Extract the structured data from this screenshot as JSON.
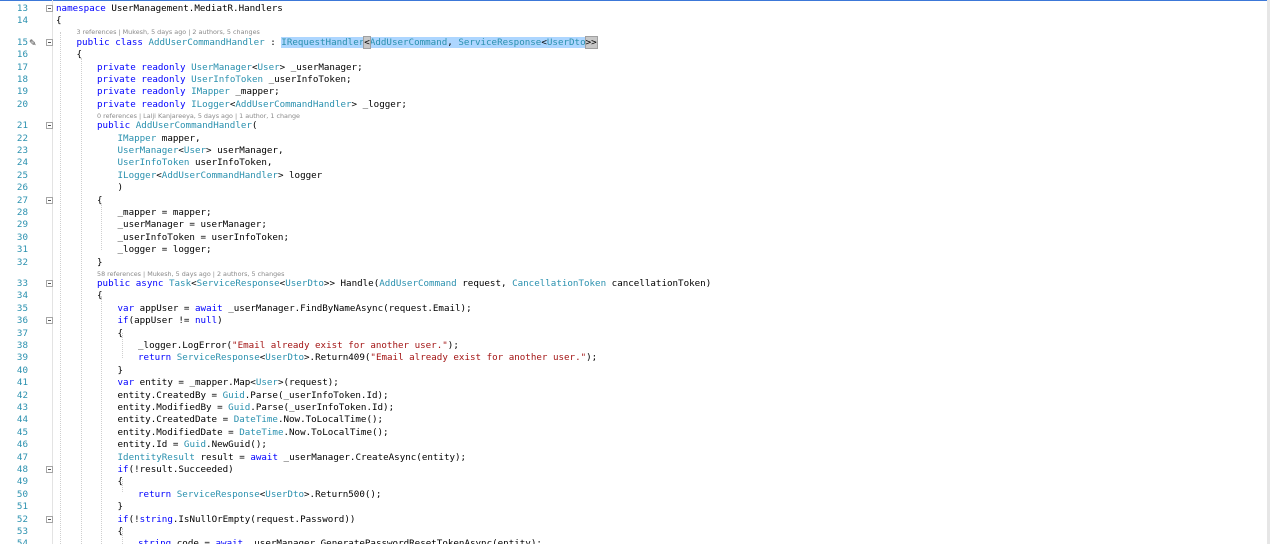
{
  "editor": {
    "lines": [
      {
        "n": "13",
        "indent": 0,
        "fold": "open",
        "segs": [
          [
            "k",
            "namespace"
          ],
          [
            "",
            "UserManagement.MediatR.Handlers"
          ]
        ]
      },
      {
        "n": "14",
        "indent": 0,
        "segs": [
          [
            "",
            "{"
          ]
        ]
      },
      {
        "lens": "3 references | Mukesh, 5 days ago | 2 authors, 5 changes",
        "indent": 1
      },
      {
        "n": "15",
        "indent": 1,
        "fold": "open",
        "editicon": true,
        "segs": [
          [
            "k",
            "public"
          ],
          [
            "",
            ""
          ],
          [
            "k",
            "class"
          ],
          [
            "",
            ""
          ],
          [
            "t",
            "AddUserCommandHandler"
          ],
          [
            "",
            ":"
          ],
          [
            "sel-t",
            "IRequestHandler"
          ],
          [
            "sel-b",
            "<"
          ],
          [
            "sel-t",
            "AddUserCommand"
          ],
          [
            "sel",
            ","
          ],
          [
            "sel-t",
            "ServiceResponse"
          ],
          [
            "sel",
            "<"
          ],
          [
            "sel-t",
            "UserDto"
          ],
          [
            "sel-b",
            ">>"
          ]
        ]
      },
      {
        "n": "16",
        "indent": 1,
        "segs": [
          [
            "",
            "{"
          ]
        ]
      },
      {
        "n": "17",
        "indent": 2,
        "segs": [
          [
            "k",
            "private"
          ],
          [
            "k",
            "readonly"
          ],
          [
            "t",
            "UserManager"
          ],
          [
            "",
            "<"
          ],
          [
            "t",
            "User"
          ],
          [
            "",
            "> _userManager;"
          ]
        ]
      },
      {
        "n": "18",
        "indent": 2,
        "segs": [
          [
            "k",
            "private"
          ],
          [
            "k",
            "readonly"
          ],
          [
            "t",
            "UserInfoToken"
          ],
          [
            "",
            "_userInfoToken;"
          ]
        ]
      },
      {
        "n": "19",
        "indent": 2,
        "segs": [
          [
            "k",
            "private"
          ],
          [
            "k",
            "readonly"
          ],
          [
            "t",
            "IMapper"
          ],
          [
            "",
            "_mapper;"
          ]
        ]
      },
      {
        "n": "20",
        "indent": 2,
        "segs": [
          [
            "k",
            "private"
          ],
          [
            "k",
            "readonly"
          ],
          [
            "t",
            "ILogger"
          ],
          [
            "",
            "<"
          ],
          [
            "t",
            "AddUserCommandHandler"
          ],
          [
            "",
            "> _logger;"
          ]
        ]
      },
      {
        "lens": "0 references | Lalji Kanjareeya, 5 days ago | 1 author, 1 change",
        "indent": 2
      },
      {
        "n": "21",
        "indent": 2,
        "fold": "open",
        "segs": [
          [
            "k",
            "public"
          ],
          [
            "t",
            "AddUserCommandHandler"
          ],
          [
            "",
            "("
          ]
        ]
      },
      {
        "n": "22",
        "indent": 3,
        "segs": [
          [
            "t",
            "IMapper"
          ],
          [
            "",
            "mapper,"
          ]
        ]
      },
      {
        "n": "23",
        "indent": 3,
        "segs": [
          [
            "t",
            "UserManager"
          ],
          [
            "",
            "<"
          ],
          [
            "t",
            "User"
          ],
          [
            "",
            "> userManager,"
          ]
        ]
      },
      {
        "n": "24",
        "indent": 3,
        "segs": [
          [
            "t",
            "UserInfoToken"
          ],
          [
            "",
            "userInfoToken,"
          ]
        ]
      },
      {
        "n": "25",
        "indent": 3,
        "segs": [
          [
            "t",
            "ILogger"
          ],
          [
            "",
            "<"
          ],
          [
            "t",
            "AddUserCommandHandler"
          ],
          [
            "",
            "> logger"
          ]
        ]
      },
      {
        "n": "26",
        "indent": 3,
        "segs": [
          [
            "",
            ")"
          ]
        ]
      },
      {
        "n": "27",
        "indent": 2,
        "fold": "open",
        "segs": [
          [
            "",
            "{"
          ]
        ]
      },
      {
        "n": "28",
        "indent": 3,
        "segs": [
          [
            "",
            "_mapper = mapper;"
          ]
        ]
      },
      {
        "n": "29",
        "indent": 3,
        "segs": [
          [
            "",
            "_userManager = userManager;"
          ]
        ]
      },
      {
        "n": "30",
        "indent": 3,
        "segs": [
          [
            "",
            "_userInfoToken = userInfoToken;"
          ]
        ]
      },
      {
        "n": "31",
        "indent": 3,
        "segs": [
          [
            "",
            "_logger = logger;"
          ]
        ]
      },
      {
        "n": "32",
        "indent": 2,
        "segs": [
          [
            "",
            "}"
          ]
        ]
      },
      {
        "lens": "58 references | Mukesh, 5 days ago | 2 authors, 5 changes",
        "indent": 2
      },
      {
        "n": "33",
        "indent": 2,
        "fold": "open",
        "segs": [
          [
            "k",
            "public"
          ],
          [
            "k",
            "async"
          ],
          [
            "t",
            "Task"
          ],
          [
            "",
            "<"
          ],
          [
            "t",
            "ServiceResponse"
          ],
          [
            "",
            "<"
          ],
          [
            "t",
            "UserDto"
          ],
          [
            "",
            ">> Handle("
          ],
          [
            "t",
            "AddUserCommand"
          ],
          [
            "",
            "request,"
          ],
          [
            "t",
            "CancellationToken"
          ],
          [
            "",
            "cancellationToken)"
          ]
        ]
      },
      {
        "n": "34",
        "indent": 2,
        "segs": [
          [
            "",
            "{"
          ]
        ]
      },
      {
        "n": "35",
        "indent": 3,
        "segs": [
          [
            "k",
            "var"
          ],
          [
            "",
            "appUser ="
          ],
          [
            "k",
            "await"
          ],
          [
            "",
            "_userManager.FindByNameAsync(request.Email);"
          ]
        ]
      },
      {
        "n": "36",
        "indent": 3,
        "fold": "open",
        "segs": [
          [
            "k",
            "if"
          ],
          [
            "",
            "(appUser !="
          ],
          [
            "k",
            "null"
          ],
          [
            "",
            ")"
          ]
        ]
      },
      {
        "n": "37",
        "indent": 3,
        "segs": [
          [
            "",
            "{"
          ]
        ]
      },
      {
        "n": "38",
        "indent": 4,
        "segs": [
          [
            "",
            "_logger.LogError("
          ],
          [
            "s",
            "\"Email already exist for another user.\""
          ],
          [
            "",
            ");"
          ]
        ]
      },
      {
        "n": "39",
        "indent": 4,
        "segs": [
          [
            "k",
            "return"
          ],
          [
            "t",
            "ServiceResponse"
          ],
          [
            "",
            "<"
          ],
          [
            "t",
            "UserDto"
          ],
          [
            "",
            ">.Return409("
          ],
          [
            "s",
            "\"Email already exist for another user.\""
          ],
          [
            "",
            ");"
          ]
        ]
      },
      {
        "n": "40",
        "indent": 3,
        "segs": [
          [
            "",
            "}"
          ]
        ]
      },
      {
        "n": "41",
        "indent": 3,
        "segs": [
          [
            "k",
            "var"
          ],
          [
            "",
            "entity = _mapper.Map<"
          ],
          [
            "t",
            "User"
          ],
          [
            "",
            ">(request);"
          ]
        ]
      },
      {
        "n": "42",
        "indent": 3,
        "segs": [
          [
            "",
            "entity.CreatedBy ="
          ],
          [
            "t",
            "Guid"
          ],
          [
            "",
            ".Parse(_userInfoToken.Id);"
          ]
        ]
      },
      {
        "n": "43",
        "indent": 3,
        "segs": [
          [
            "",
            "entity.ModifiedBy ="
          ],
          [
            "t",
            "Guid"
          ],
          [
            "",
            ".Parse(_userInfoToken.Id);"
          ]
        ]
      },
      {
        "n": "44",
        "indent": 3,
        "segs": [
          [
            "",
            "entity.CreatedDate ="
          ],
          [
            "t",
            "DateTime"
          ],
          [
            "",
            ".Now.ToLocalTime();"
          ]
        ]
      },
      {
        "n": "45",
        "indent": 3,
        "segs": [
          [
            "",
            "entity.ModifiedDate ="
          ],
          [
            "t",
            "DateTime"
          ],
          [
            "",
            ".Now.ToLocalTime();"
          ]
        ]
      },
      {
        "n": "46",
        "indent": 3,
        "segs": [
          [
            "",
            "entity.Id ="
          ],
          [
            "t",
            "Guid"
          ],
          [
            "",
            ".NewGuid();"
          ]
        ]
      },
      {
        "n": "47",
        "indent": 3,
        "segs": [
          [
            "t",
            "IdentityResult"
          ],
          [
            "",
            "result ="
          ],
          [
            "k",
            "await"
          ],
          [
            "",
            "_userManager.CreateAsync(entity);"
          ]
        ]
      },
      {
        "n": "48",
        "indent": 3,
        "fold": "open",
        "segs": [
          [
            "k",
            "if"
          ],
          [
            "",
            "(!result.Succeeded)"
          ]
        ]
      },
      {
        "n": "49",
        "indent": 3,
        "segs": [
          [
            "",
            "{"
          ]
        ]
      },
      {
        "n": "50",
        "indent": 4,
        "segs": [
          [
            "k",
            "return"
          ],
          [
            "t",
            "ServiceResponse"
          ],
          [
            "",
            "<"
          ],
          [
            "t",
            "UserDto"
          ],
          [
            "",
            ">.Return500();"
          ]
        ]
      },
      {
        "n": "51",
        "indent": 3,
        "segs": [
          [
            "",
            "}"
          ]
        ]
      },
      {
        "n": "52",
        "indent": 3,
        "fold": "open",
        "segs": [
          [
            "k",
            "if"
          ],
          [
            "",
            "(!"
          ],
          [
            "k",
            "string"
          ],
          [
            "",
            ".IsNullOrEmpty(request.Password))"
          ]
        ]
      },
      {
        "n": "53",
        "indent": 3,
        "segs": [
          [
            "",
            "{"
          ]
        ]
      },
      {
        "n": "54",
        "indent": 4,
        "segs": [
          [
            "k",
            "string"
          ],
          [
            "",
            "code ="
          ],
          [
            "k",
            "await"
          ],
          [
            "",
            "_userManager.GeneratePasswordResetTokenAsync(entity);"
          ]
        ]
      }
    ]
  }
}
